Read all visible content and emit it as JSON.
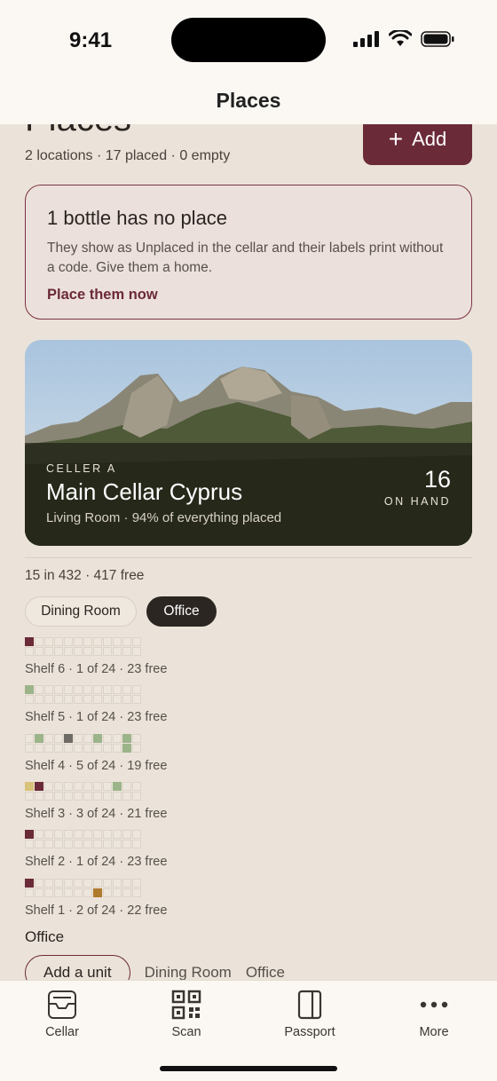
{
  "status_bar": {
    "time": "9:41"
  },
  "nav": {
    "title": "Places"
  },
  "header": {
    "title": "Places",
    "summary": "2 locations · 17 placed · 0 empty",
    "add_label": "Add"
  },
  "notice": {
    "title": "1 bottle has no place",
    "body": "They show as Unplaced in the cellar and their labels print without a code. Give them a home.",
    "link": "Place them now"
  },
  "location_card": {
    "eyebrow": "CELLER A",
    "name": "Main Cellar Cyprus",
    "meta": "Living Room · 94% of everything placed",
    "count": "16",
    "count_label": "ON HAND"
  },
  "capacity": "15 in 432 · 417 free",
  "room_chips": [
    {
      "label": "Dining Room",
      "selected": false
    },
    {
      "label": "Office",
      "selected": true
    }
  ],
  "colors": {
    "red": "#6b2a38",
    "green": "#9cb48a",
    "gray": "#6e6a64",
    "gold": "#d8c27a",
    "amber": "#b07a2e",
    "accent": "#6b2a38"
  },
  "shelves": [
    {
      "label": "Shelf 6 · 1 of 24 · 23 free",
      "filled": [
        {
          "slot": 0,
          "color": "red"
        }
      ]
    },
    {
      "label": "Shelf 5 · 1 of 24 · 23 free",
      "filled": [
        {
          "slot": 0,
          "color": "green"
        }
      ]
    },
    {
      "label": "Shelf 4 · 5 of 24 · 19 free",
      "filled": [
        {
          "slot": 1,
          "color": "green"
        },
        {
          "slot": 4,
          "color": "gray"
        },
        {
          "slot": 7,
          "color": "green"
        },
        {
          "slot": 10,
          "color": "green"
        },
        {
          "slot": 22,
          "color": "green"
        }
      ]
    },
    {
      "label": "Shelf 3 · 3 of 24 · 21 free",
      "filled": [
        {
          "slot": 0,
          "color": "gold"
        },
        {
          "slot": 1,
          "color": "red"
        },
        {
          "slot": 9,
          "color": "green"
        }
      ]
    },
    {
      "label": "Shelf 2 · 1 of 24 · 23 free",
      "filled": [
        {
          "slot": 0,
          "color": "red"
        }
      ]
    },
    {
      "label": "Shelf 1 · 2 of 24 · 22 free",
      "filled": [
        {
          "slot": 0,
          "color": "red"
        },
        {
          "slot": 19,
          "color": "amber"
        }
      ]
    }
  ],
  "section_office": "Office",
  "bottom_chips": {
    "add_unit": "Add a unit",
    "dining": "Dining Room",
    "office": "Office"
  },
  "tabs": [
    {
      "label": "Cellar",
      "icon": "cellar-icon"
    },
    {
      "label": "Scan",
      "icon": "qr-icon"
    },
    {
      "label": "Passport",
      "icon": "passport-icon"
    },
    {
      "label": "More",
      "icon": "more-icon"
    }
  ]
}
